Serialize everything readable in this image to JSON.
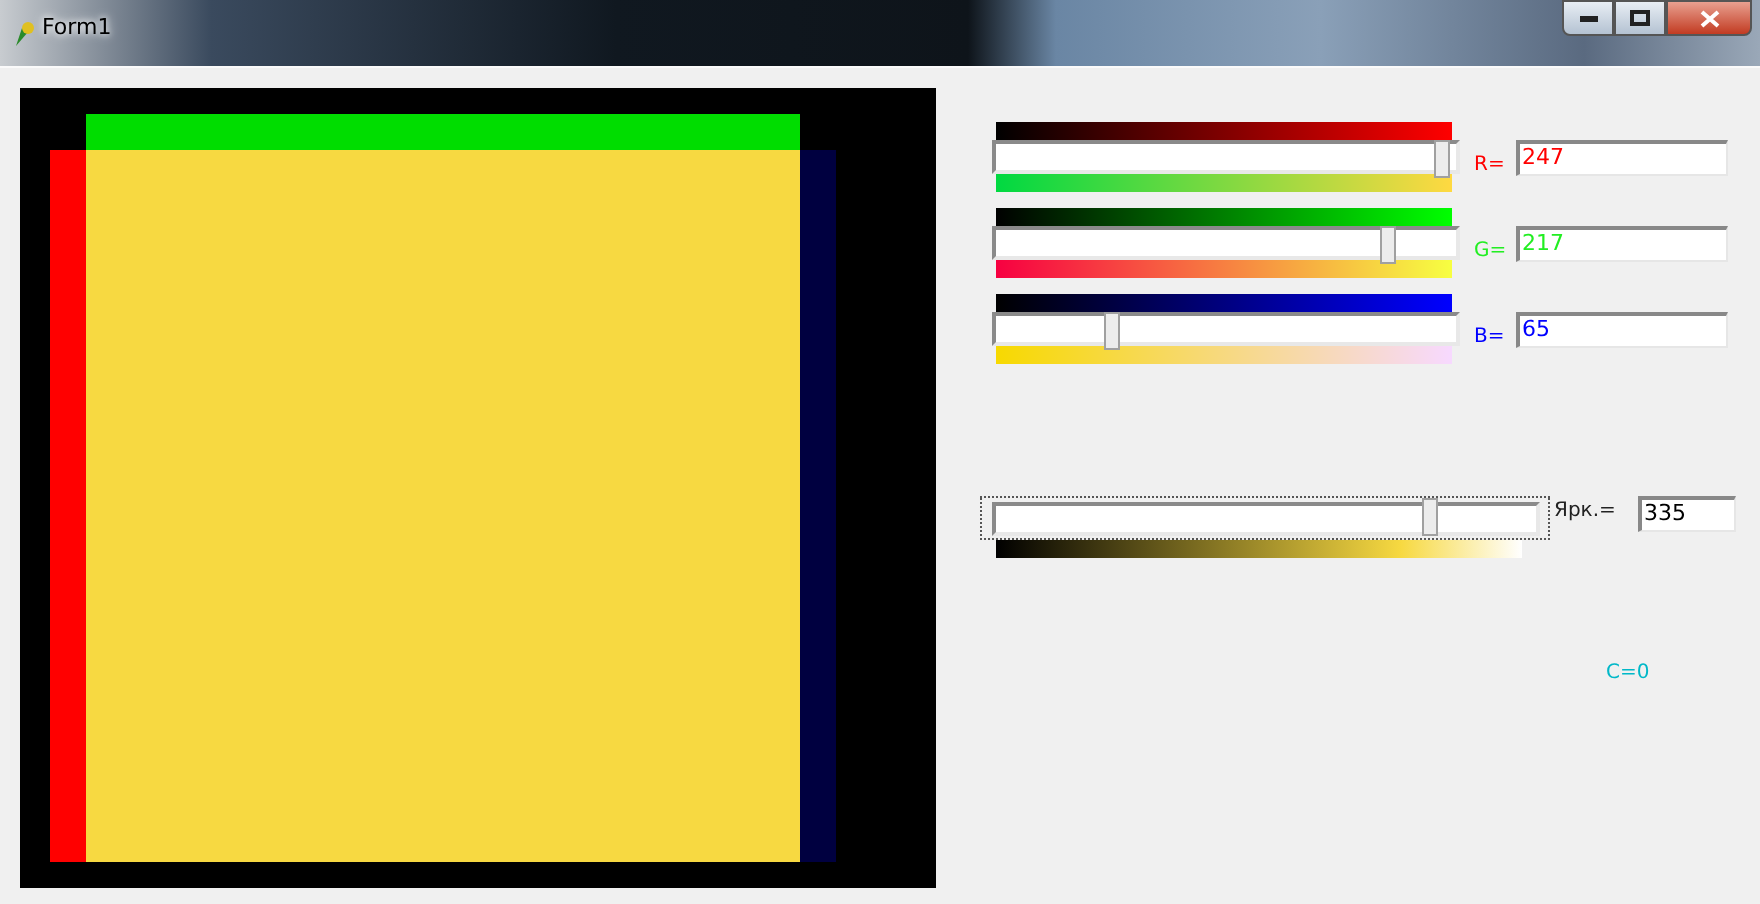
{
  "window": {
    "title": "Form1"
  },
  "swatch": {
    "color": "#f7d941"
  },
  "channels": [
    {
      "kind": "red",
      "label": "R=",
      "value": "247",
      "level": 0.97,
      "color": "#ff0000"
    },
    {
      "kind": "green",
      "label": "G=",
      "value": "217",
      "level": 0.85,
      "color": "#22ee22"
    },
    {
      "kind": "blue",
      "label": "B=",
      "value": "65",
      "level": 0.25,
      "color": "#0000ff"
    }
  ],
  "brightness": {
    "label": "Ярк.=",
    "value": "335",
    "level": 0.8,
    "focused": true
  },
  "status_label": {
    "text": "C=0"
  }
}
